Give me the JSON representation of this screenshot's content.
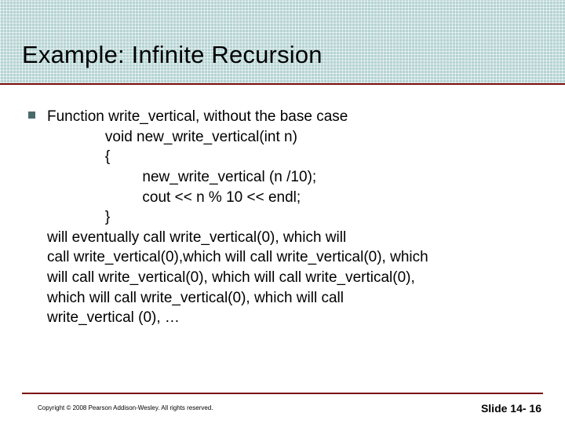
{
  "title": "Example: Infinite Recursion",
  "body": {
    "l1": "Function write_vertical, without the base case",
    "l2": "              void new_write_vertical(int n)",
    "l3": "              {",
    "l4": "                       new_write_vertical (n /10);",
    "l5": "                       cout << n % 10 << endl;",
    "l6": "              }",
    "l7": "will eventually call write_vertical(0), which will",
    "l8": "call write_vertical(0),which will call write_vertical(0), which",
    "l9": "will call write_vertical(0), which will call write_vertical(0),",
    "l10": "which will call write_vertical(0), which will call",
    "l11": "write_vertical (0), …"
  },
  "footer": {
    "copyright": "Copyright © 2008 Pearson Addison-Wesley.  All rights reserved.",
    "slide_label": "Slide 14- 16"
  }
}
